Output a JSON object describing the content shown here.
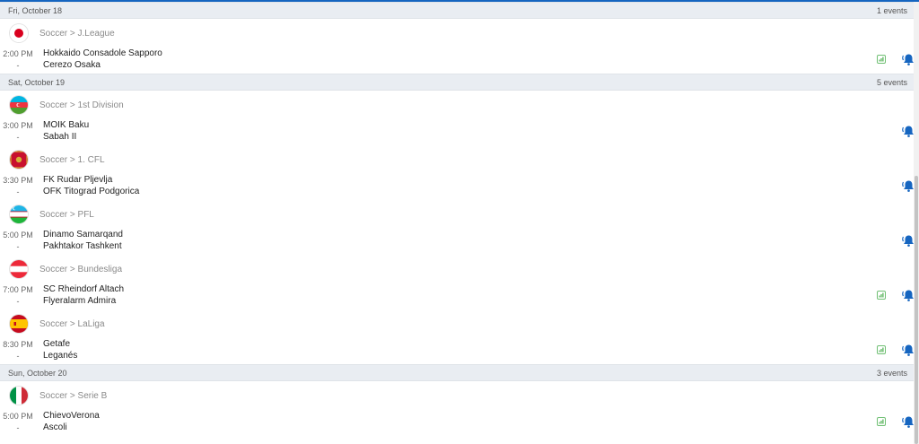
{
  "days": [
    {
      "date": "Fri, October 18",
      "count": "1 events",
      "leagues": [
        {
          "label": "Soccer > J.League",
          "flag": "japan-flag",
          "events": [
            {
              "time": "2:00 PM",
              "status": "-",
              "home": "Hokkaido Consadole Sapporo",
              "away": "Cerezo Osaka",
              "stats": true
            }
          ]
        }
      ]
    },
    {
      "date": "Sat, October 19",
      "count": "5 events",
      "leagues": [
        {
          "label": "Soccer > 1st Division",
          "flag": "azerbaijan-flag",
          "events": [
            {
              "time": "3:00 PM",
              "status": "-",
              "home": "MOIK Baku",
              "away": "Sabah II",
              "stats": false
            }
          ]
        },
        {
          "label": "Soccer > 1. CFL",
          "flag": "montenegro-flag",
          "events": [
            {
              "time": "3:30 PM",
              "status": "-",
              "home": "FK Rudar Pljevlja",
              "away": "OFK Titograd Podgorica",
              "stats": false
            }
          ]
        },
        {
          "label": "Soccer > PFL",
          "flag": "uzbekistan-flag",
          "events": [
            {
              "time": "5:00 PM",
              "status": "-",
              "home": "Dinamo Samarqand",
              "away": "Pakhtakor Tashkent",
              "stats": false
            }
          ]
        },
        {
          "label": "Soccer > Bundesliga",
          "flag": "austria-flag",
          "events": [
            {
              "time": "7:00 PM",
              "status": "-",
              "home": "SC Rheindorf Altach",
              "away": "Flyeralarm Admira",
              "stats": true
            }
          ]
        },
        {
          "label": "Soccer > LaLiga",
          "flag": "spain-flag",
          "events": [
            {
              "time": "8:30 PM",
              "status": "-",
              "home": "Getafe",
              "away": "Leganés",
              "stats": true
            }
          ]
        }
      ]
    },
    {
      "date": "Sun, October 20",
      "count": "3 events",
      "leagues": [
        {
          "label": "Soccer > Serie B",
          "flag": "italy-flag",
          "events": [
            {
              "time": "5:00 PM",
              "status": "-",
              "home": "ChievoVerona",
              "away": "Ascoli",
              "stats": true
            }
          ]
        }
      ]
    }
  ],
  "icons": {
    "stats": "stats-bar-chart-icon",
    "notify": "bell-notification-icon"
  },
  "colors": {
    "accent_blue": "#1565c0",
    "bell_blue": "#1565c0",
    "stats_green": "#4caf50",
    "day_header_bg": "#e9edf2"
  }
}
